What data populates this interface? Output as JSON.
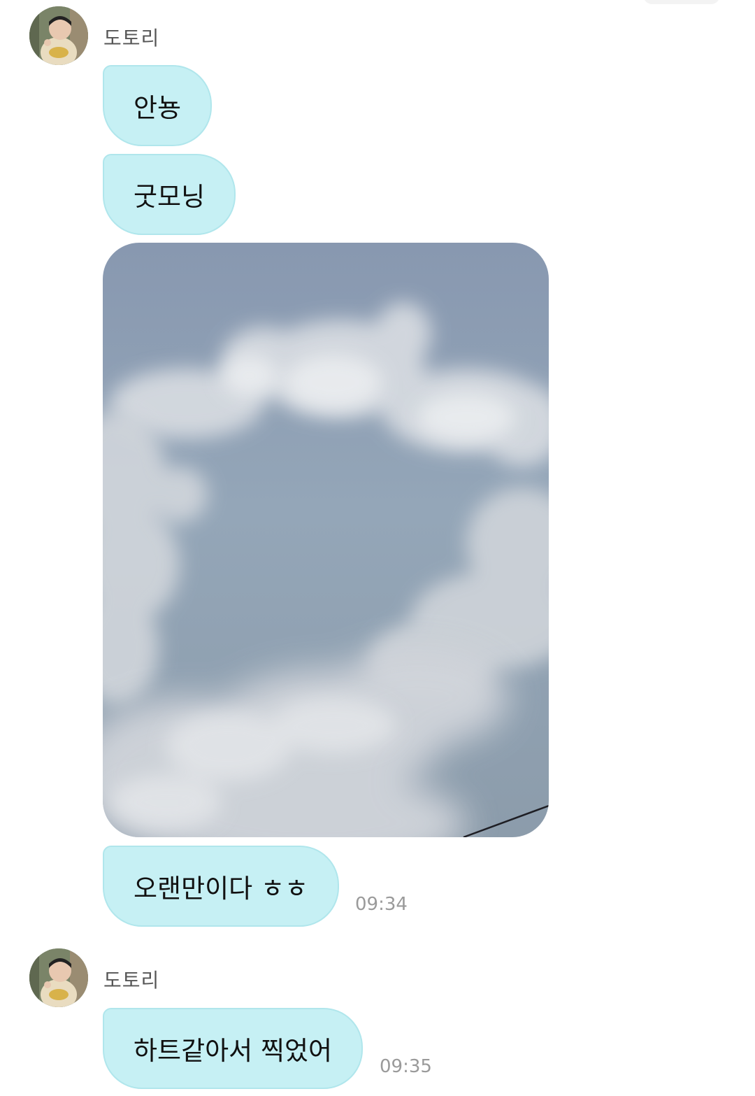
{
  "messages": [
    {
      "sender": "도토리",
      "texts": [
        "안뇽",
        "굿모닝"
      ]
    },
    {
      "image": "sky-photo-heart-clouds"
    },
    {
      "text": "오랜만이다 ㅎㅎ",
      "time": "09:34"
    },
    {
      "sender": "도토리",
      "text": "하트같아서 찍었어",
      "time": "09:35"
    }
  ],
  "colors": {
    "bubble": "#c6f0f4",
    "bubble_border": "#b0e6ec",
    "timestamp": "#9a9a9a",
    "sender": "#555555"
  },
  "icons": {
    "avatar": "profile-photo-child"
  }
}
